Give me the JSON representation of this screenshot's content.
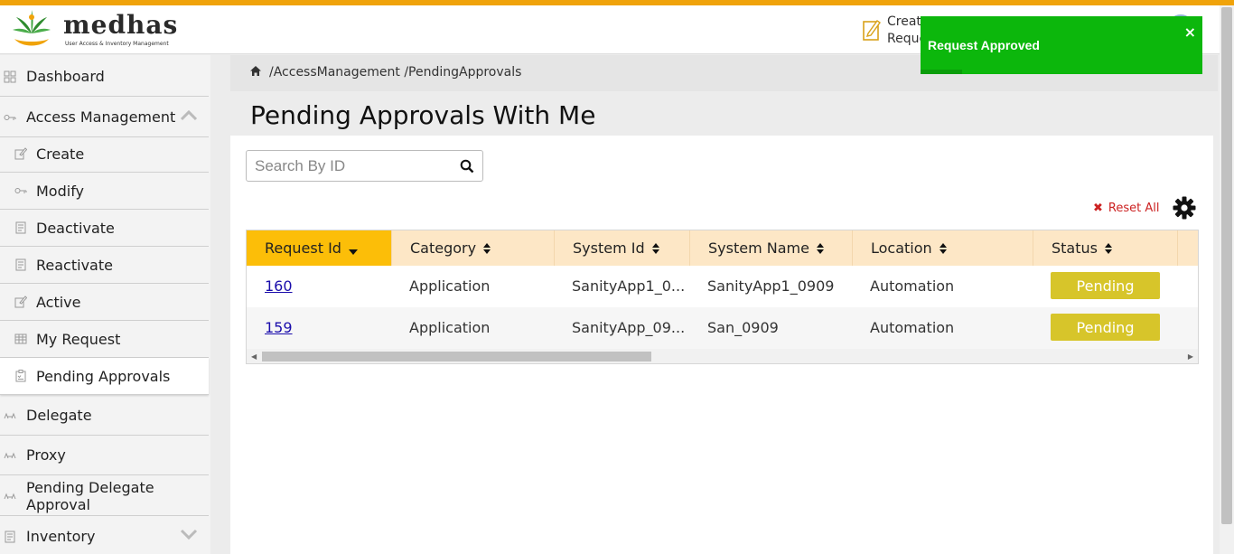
{
  "header": {
    "logo_text": "medhas",
    "logo_sub": "User Access & Inventory Management",
    "create_line1": "Create",
    "create_line2": "Request"
  },
  "sidebar": {
    "items": [
      {
        "label": "Dashboard",
        "icon": "grid-icon"
      },
      {
        "label": "Access Management",
        "icon": "key-icon"
      },
      {
        "label": "Create",
        "icon": "edit-icon"
      },
      {
        "label": "Modify",
        "icon": "key-icon"
      },
      {
        "label": "Deactivate",
        "icon": "document-icon"
      },
      {
        "label": "Reactivate",
        "icon": "document-icon"
      },
      {
        "label": "Active",
        "icon": "edit-icon"
      },
      {
        "label": "My Request",
        "icon": "table-icon"
      },
      {
        "label": "Pending Approvals",
        "icon": "clipboard-icon"
      },
      {
        "label": "Delegate",
        "icon": "delegate-icon"
      },
      {
        "label": "Proxy",
        "icon": "delegate-icon"
      },
      {
        "label": "Pending Delegate Approval",
        "icon": "delegate-icon"
      },
      {
        "label": "Inventory",
        "icon": "document-icon"
      }
    ]
  },
  "breadcrumb": "/AccessManagement /PendingApprovals",
  "page_title": "Pending Approvals With Me",
  "search": {
    "placeholder": "Search By ID"
  },
  "reset_label": "Reset All",
  "table": {
    "columns": [
      "Request Id",
      "Category",
      "System Id",
      "System Name",
      "Location",
      "Status"
    ],
    "rows": [
      {
        "request_id": "160",
        "category": "Application",
        "system_id": "SanityApp1_0...",
        "system_name": "SanityApp1_0909",
        "location": "Automation",
        "status": "Pending"
      },
      {
        "request_id": "159",
        "category": "Application",
        "system_id": "SanityApp_09...",
        "system_name": "San_0909",
        "location": "Automation",
        "status": "Pending"
      }
    ]
  },
  "toast": {
    "message": "Request Approved",
    "close": "×"
  },
  "colors": {
    "accent": "#f0a30a",
    "sorted_header": "#fcbe08",
    "header_bg": "#fde7c6",
    "pending_badge": "#d7c52a",
    "toast_bg": "#0cb70c",
    "reset_red": "#cc2222"
  }
}
